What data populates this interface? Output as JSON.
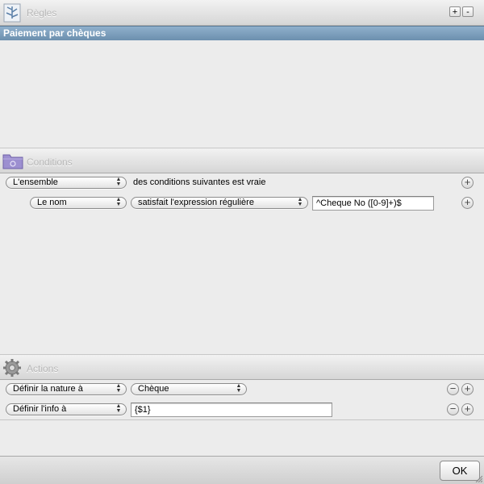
{
  "header": {
    "title": "Règles",
    "add_label": "+",
    "remove_label": "-"
  },
  "rule": {
    "name": "Paiement par chèques"
  },
  "conditions": {
    "title": "Conditions",
    "quantifier": "L'ensemble",
    "quantifier_suffix": "des conditions suivantes est vraie",
    "rows": [
      {
        "field": "Le nom",
        "operator": "satisfait l'expression régulière",
        "value": "^Cheque No ([0-9]+)$"
      }
    ]
  },
  "actions": {
    "title": "Actions",
    "rows": [
      {
        "action": "Définir la nature à",
        "value": "Chèque"
      },
      {
        "action": "Définir l'info à",
        "value": "{$1}"
      }
    ]
  },
  "footer": {
    "ok_label": "OK"
  },
  "icons": {
    "rules": "rules-tree-icon",
    "conditions": "folder-icon",
    "actions": "gear-icon",
    "add": "plus-circle-icon",
    "remove": "minus-circle-icon"
  },
  "colors": {
    "selection": "#7896b4",
    "background": "#ececec"
  }
}
